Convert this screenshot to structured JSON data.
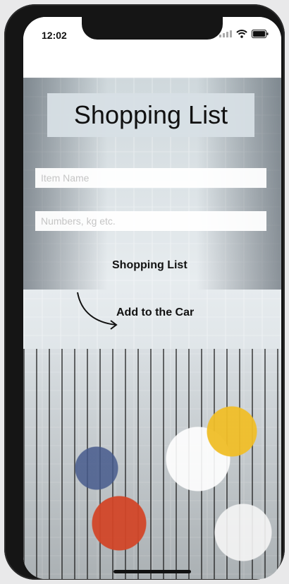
{
  "status": {
    "time": "12:02"
  },
  "header": {
    "title": "Shopping List"
  },
  "form": {
    "item_placeholder": "Item Name",
    "qty_placeholder": "Numbers, kg etc."
  },
  "actions": {
    "list_label": "Shopping List",
    "add_label": "Add to the Car"
  },
  "icons": [
    "signal-icon",
    "wifi-icon",
    "battery-icon",
    "curved-arrow-icon"
  ]
}
